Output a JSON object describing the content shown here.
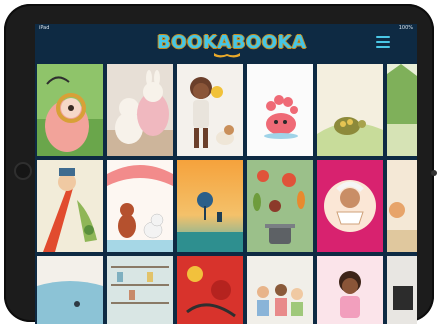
{
  "status_bar": {
    "left": "iPad",
    "right": "100%"
  },
  "header": {
    "logo_text": "BOOKABOOKA",
    "menu_icon": "hamburger-menu-icon"
  },
  "colors": {
    "header_bg": "#0e2a43",
    "logo_blue": "#45c6e6",
    "logo_outline": "#c98c1b",
    "menu_accent": "#4ac7e6"
  },
  "books": [
    {
      "id": "book-magnifier-girl",
      "icon": "magnifier-girl-illustration"
    },
    {
      "id": "book-plush-bunnies",
      "icon": "plush-bunnies-illustration"
    },
    {
      "id": "book-girl-with-dog",
      "icon": "girl-with-dog-photo"
    },
    {
      "id": "book-coral-creature",
      "icon": "coral-creature-illustration"
    },
    {
      "id": "book-turtle",
      "icon": "turtle-illustration"
    },
    {
      "id": "book-green-partial",
      "icon": "green-landscape-illustration"
    },
    {
      "id": "book-tall-hat-kid",
      "icon": "tall-hat-kid-illustration"
    },
    {
      "id": "book-bear-and-dog",
      "icon": "bear-and-dog-illustration"
    },
    {
      "id": "book-sunset-tree",
      "icon": "sunset-tree-illustration"
    },
    {
      "id": "book-vegetable-pot",
      "icon": "vegetable-pot-illustration"
    },
    {
      "id": "book-grandma-teacup",
      "icon": "grandma-teacup-illustration"
    },
    {
      "id": "book-partial-right",
      "icon": "partial-book-illustration"
    },
    {
      "id": "book-seascape",
      "icon": "seascape-illustration"
    },
    {
      "id": "book-shelves",
      "icon": "shelves-illustration"
    },
    {
      "id": "book-red-curls",
      "icon": "red-curls-illustration"
    },
    {
      "id": "book-kids-group",
      "icon": "kids-group-illustration"
    },
    {
      "id": "book-girl-pink",
      "icon": "girl-pink-illustration"
    },
    {
      "id": "book-dark-partial",
      "icon": "dark-partial-illustration"
    }
  ]
}
